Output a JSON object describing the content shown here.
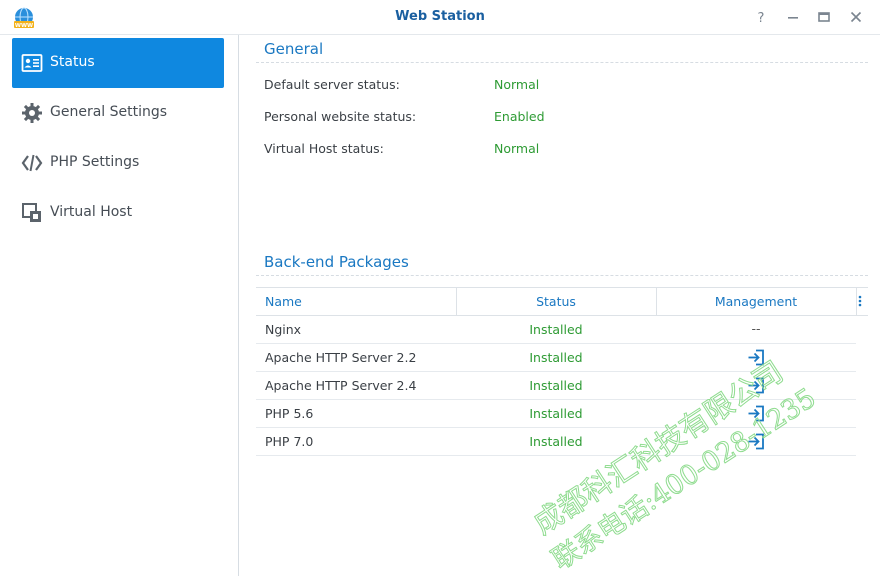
{
  "window": {
    "title": "Web Station",
    "icon": "web-station-globe-icon"
  },
  "window_controls": [
    "help-icon",
    "minimize-icon",
    "maximize-icon",
    "close-icon"
  ],
  "sidebar": {
    "items": [
      {
        "label": "Status",
        "icon": "status-card-icon",
        "active": true
      },
      {
        "label": "General Settings",
        "icon": "gear-icon",
        "active": false
      },
      {
        "label": "PHP Settings",
        "icon": "code-brackets-icon",
        "active": false
      },
      {
        "label": "Virtual Host",
        "icon": "virtual-host-icon",
        "active": false
      }
    ]
  },
  "general": {
    "title": "General",
    "rows": [
      {
        "label": "Default server status:",
        "value": "Normal"
      },
      {
        "label": "Personal website status:",
        "value": "Enabled"
      },
      {
        "label": "Virtual Host status:",
        "value": "Normal"
      }
    ]
  },
  "backend": {
    "title": "Back-end Packages",
    "columns": [
      "Name",
      "Status",
      "Management"
    ],
    "rows": [
      {
        "name": "Nginx",
        "status": "Installed",
        "management": "--"
      },
      {
        "name": "Apache HTTP Server 2.2",
        "status": "Installed",
        "management": "open-in-icon"
      },
      {
        "name": "Apache HTTP Server 2.4",
        "status": "Installed",
        "management": "open-in-icon"
      },
      {
        "name": "PHP 5.6",
        "status": "Installed",
        "management": "open-in-icon"
      },
      {
        "name": "PHP 7.0",
        "status": "Installed",
        "management": "open-in-icon"
      }
    ]
  },
  "watermark": {
    "line1": "成都科汇科技有限公司",
    "line2": "联系电话:400-028-1235"
  },
  "colors": {
    "accent": "#0f88e0",
    "title_blue": "#1a78c2",
    "status_green": "#2e9b34",
    "watermark_green": "#8fdc8f"
  }
}
